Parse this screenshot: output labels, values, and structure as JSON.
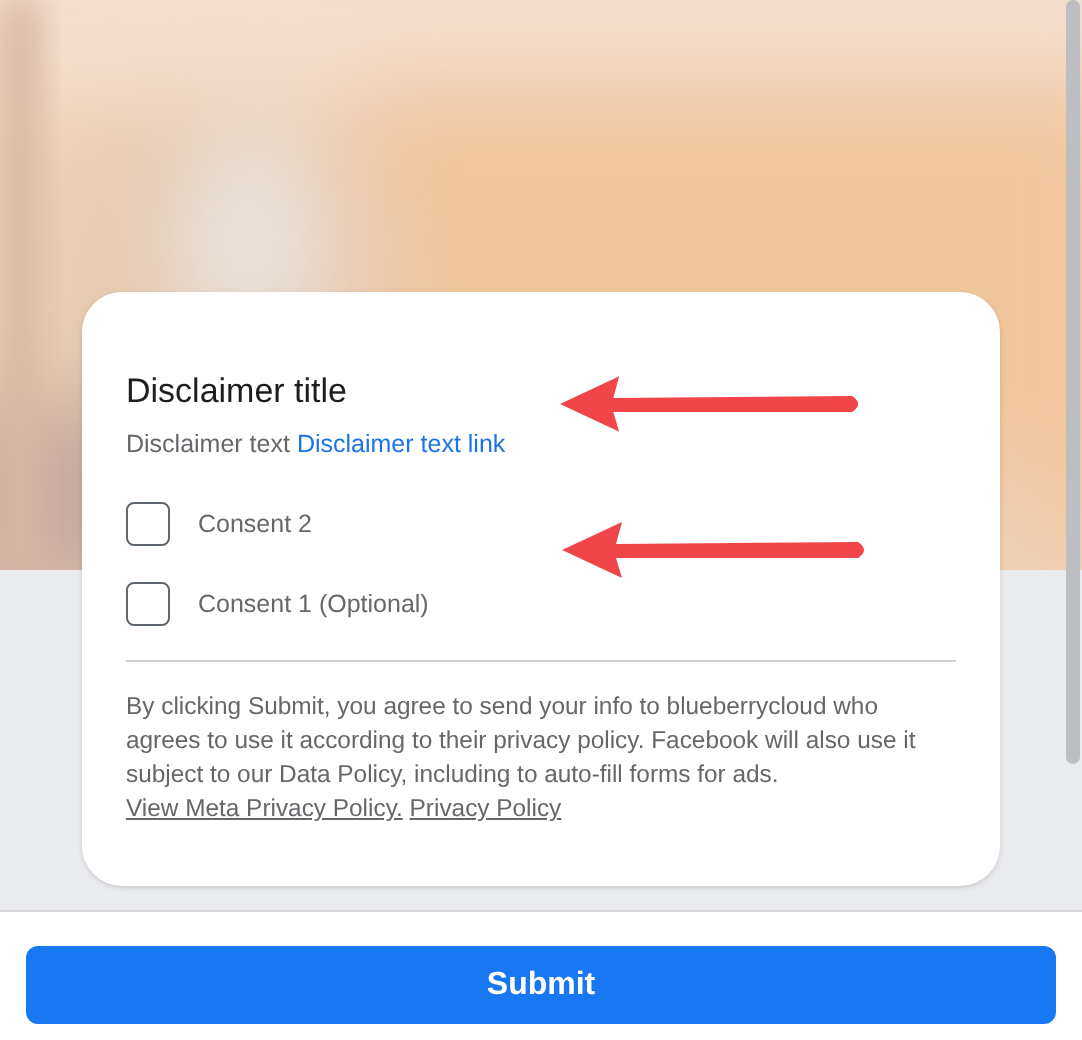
{
  "disclaimer": {
    "title": "Disclaimer title",
    "text": "Disclaimer text",
    "link": "Disclaimer text link"
  },
  "consents": [
    {
      "label": "Consent 2",
      "checked": false
    },
    {
      "label": "Consent 1 (Optional)",
      "checked": false
    }
  ],
  "legal": {
    "text": "By clicking Submit, you agree to send your info to blueberrycloud who agrees to use it according to their privacy policy. Facebook will also use it subject to our Data Policy, including to auto-fill forms for ads.",
    "links": [
      "View Meta Privacy Policy.",
      "Privacy Policy"
    ]
  },
  "submit_button": "Submit"
}
